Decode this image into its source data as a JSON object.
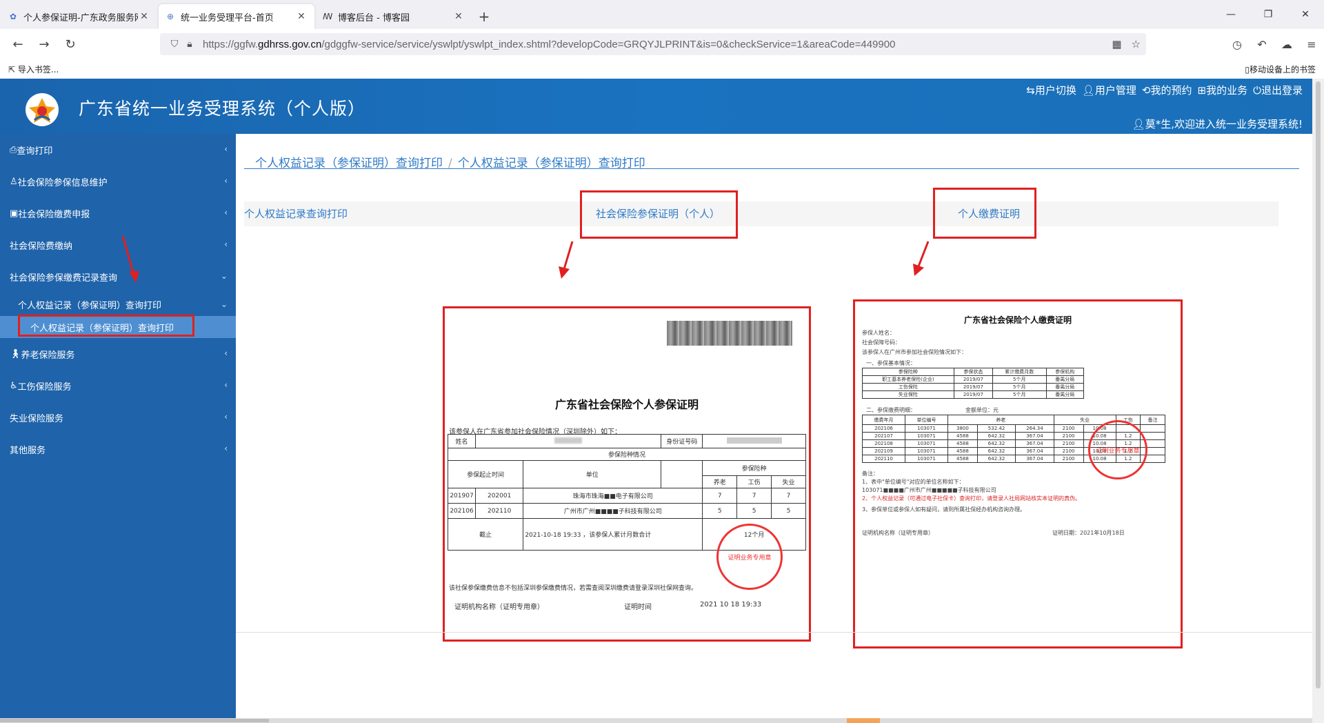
{
  "browser": {
    "tabs": [
      {
        "label": "个人参保证明-广东政务服务网",
        "icon": "gov-icon"
      },
      {
        "label": "统一业务受理平台-首页",
        "icon": "globe-icon"
      },
      {
        "label": "博客后台 - 博客园",
        "icon": "blog-icon"
      }
    ],
    "url_prefix": "https://ggfw.",
    "url_domain": "gdhrss.gov.cn",
    "url_suffix": "/gdggfw-service/service/yswlpt/yswlpt_index.shtml?developCode=GRQYJLPRINT&is=0&checkService=1&areaCode=449900",
    "bookmark_import": "导入书签...",
    "bookmark_mobile": "移动设备上的书签"
  },
  "header": {
    "title": "广东省统一业务受理系统（个人版）",
    "menu": [
      "用户切换",
      "用户管理",
      "我的预约",
      "我的业务",
      "退出登录"
    ],
    "welcome": "莫*生,欢迎进入统一业务受理系统!"
  },
  "sidebar": {
    "items": [
      {
        "label": "查询打印"
      },
      {
        "label": "社会保险参保信息维护"
      },
      {
        "label": "社会保险缴费申报"
      },
      {
        "label": "社会保险费缴纳"
      },
      {
        "label": "社会保险参保缴费记录查询"
      }
    ],
    "sub": "个人权益记录（参保证明）查询打印",
    "leaf": "个人权益记录（参保证明）查询打印",
    "more": [
      {
        "label": "养老保险服务"
      },
      {
        "label": "工伤保险服务"
      },
      {
        "label": "失业保险服务"
      },
      {
        "label": "其他服务"
      }
    ]
  },
  "main": {
    "breadcrumb": [
      "个人权益记录（参保证明）查询打印",
      "个人权益记录（参保证明）查询打印"
    ],
    "tab1": "个人权益记录查询打印",
    "tab2": "社会保险参保证明（个人）",
    "tab3": "个人缴费证明"
  },
  "doc1": {
    "title": "广东省社会保险个人参保证明",
    "intro": "该参保人在广东省参加社会保险情况（深圳除外）如下：",
    "name_label": "姓名",
    "id_label": "身份证号码",
    "section": "参保险种情况",
    "period": "参保起止时间",
    "unit": "单位",
    "types": "参保险种",
    "pension": "养老",
    "injury": "工伤",
    "unemp": "失业",
    "rows": [
      {
        "from": "201907",
        "to": "202001",
        "unit": "珠海市珠海■■电子有限公司",
        "a": "7",
        "b": "7",
        "c": "7"
      },
      {
        "from": "202106",
        "to": "202110",
        "unit": "广州市广州■■■■子科技有限公司",
        "a": "5",
        "b": "5",
        "c": "5"
      }
    ],
    "total_label": "截止",
    "total_text": "2021-10-18 19:33    ，该参保人累计月数合计",
    "total_months": "12个月",
    "note": "该社保参保缴费信息不包括深圳参保缴费情况，若需查阅深圳缴费请登录深圳社保网查询。",
    "org_label": "证明机构名称（证明专用章）",
    "time_label": "证明时间",
    "time_value": "2021 10 18 19:33",
    "stamp": "证明业务专用章"
  },
  "doc2": {
    "title": "广东省社会保险个人缴费证明",
    "lines": [
      "参保人姓名：",
      "社会保障号码：",
      "该参保人在广州市参加社会保险情况如下：",
      "一、参保基本情况："
    ],
    "t1_headers": [
      "参保险种",
      "参保状态",
      "累计缴费月数",
      "参保机构"
    ],
    "t1_rows": [
      [
        "职工基本养老保险(企业)",
        "2019/07",
        "5个月",
        "番禺分局"
      ],
      [
        "工伤保险",
        "2019/07",
        "5个月",
        "番禺分局"
      ],
      [
        "失业保险",
        "2019/07",
        "5个月",
        "番禺分局"
      ]
    ],
    "section2": "二、参保缴费明细：",
    "unit_note": "金额单位：元",
    "t2_headers": [
      "缴费年月",
      "单位编号",
      "养老",
      "",
      "",
      "失业",
      "",
      "工伤",
      "备注"
    ],
    "t2_rows": [
      [
        "202106",
        "103071",
        "3800",
        "532.42",
        "264.34",
        "2100",
        "10.08",
        "",
        ""
      ],
      [
        "202107",
        "103071",
        "4588",
        "642.32",
        "367.04",
        "2100",
        "10.08",
        "1.2",
        ""
      ],
      [
        "202108",
        "103071",
        "4588",
        "642.32",
        "367.04",
        "2100",
        "10.08",
        "1.2",
        ""
      ],
      [
        "202109",
        "103071",
        "4588",
        "642.32",
        "367.04",
        "2100",
        "10.08",
        "1.2",
        ""
      ],
      [
        "202110",
        "103071",
        "4588",
        "642.32",
        "367.04",
        "2100",
        "10.08",
        "1.2",
        ""
      ]
    ],
    "notes_label": "备注：",
    "note1": "1、表中\"单位编号\"对应的单位名称如下：",
    "note2": "103071■■■■广州市广州■■■■■子科技有限公司",
    "note_red": "2、个人权益记录（可通过电子社保卡）查询打印，请登录人社局网站核实本证明的真伪。",
    "note3": "3、参保单位或参保人如有疑问，请到所属社保经办机构咨询办理。",
    "footer_left": "证明机构名称（证明专用章）",
    "footer_right": "证明日期：2021年10月18日",
    "stamp": "证明业务专用章"
  }
}
